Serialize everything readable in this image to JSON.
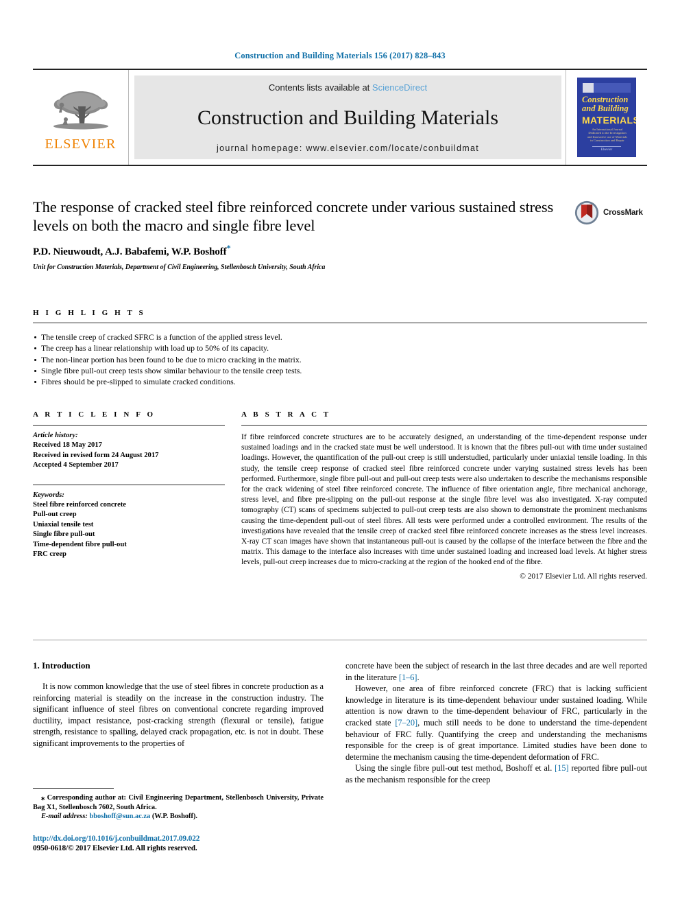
{
  "running_head": "Construction and Building Materials 156 (2017) 828–843",
  "masthead": {
    "contents_prefix": "Contents lists available at ",
    "sciencedirect": "ScienceDirect",
    "journal_title": "Construction and Building Materials",
    "homepage": "journal homepage: www.elsevier.com/locate/conbuildmat",
    "publisher_name": "ELSEVIER",
    "cover": {
      "line1": "Construction",
      "line2": "and Building",
      "line3": "MATERIALS",
      "subtitle": "An International Journal Dedicated to the Investigation and Innovative use of Materials in Construction and Repair",
      "footer": "Elsevier"
    }
  },
  "article": {
    "title": "The response of cracked steel fibre reinforced concrete under various sustained stress levels on both the macro and single fibre level",
    "authors": "P.D. Nieuwoudt, A.J. Babafemi, W.P. Boshoff",
    "corresponding_marker": "*",
    "affiliation": "Unit for Construction Materials, Department of Civil Engineering, Stellenbosch University, South Africa",
    "crossmark_label": "CrossMark"
  },
  "highlights": {
    "heading": "H I G H L I G H T S",
    "items": [
      "The tensile creep of cracked SFRC is a function of the applied stress level.",
      "The creep has a linear relationship with load up to 50% of its capacity.",
      "The non-linear portion has been found to be due to micro cracking in the matrix.",
      "Single fibre pull-out creep tests show similar behaviour to the tensile creep tests.",
      "Fibres should be pre-slipped to simulate cracked conditions."
    ]
  },
  "article_info": {
    "heading": "A R T I C L E    I N F O",
    "history_label": "Article history:",
    "received": "Received 18 May 2017",
    "revised": "Received in revised form 24 August 2017",
    "accepted": "Accepted 4 September 2017",
    "keywords_label": "Keywords:",
    "keywords": [
      "Steel fibre reinforced concrete",
      "Pull-out creep",
      "Uniaxial tensile test",
      "Single fibre pull-out",
      "Time-dependent fibre pull-out",
      "FRC creep"
    ]
  },
  "abstract": {
    "heading": "A B S T R A C T",
    "text": "If fibre reinforced concrete structures are to be accurately designed, an understanding of the time-dependent response under sustained loadings and in the cracked state must be well understood. It is known that the fibres pull-out with time under sustained loadings. However, the quantification of the pull-out creep is still understudied, particularly under uniaxial tensile loading. In this study, the tensile creep response of cracked steel fibre reinforced concrete under varying sustained stress levels has been performed. Furthermore, single fibre pull-out and pull-out creep tests were also undertaken to describe the mechanisms responsible for the crack widening of steel fibre reinforced concrete. The influence of fibre orientation angle, fibre mechanical anchorage, stress level, and fibre pre-slipping on the pull-out response at the single fibre level was also investigated. X-ray computed tomography (CT) scans of specimens subjected to pull-out creep tests are also shown to demonstrate the prominent mechanisms causing the time-dependent pull-out of steel fibres. All tests were performed under a controlled environment. The results of the investigations have revealed that the tensile creep of cracked steel fibre reinforced concrete increases as the stress level increases. X-ray CT scan images have shown that instantaneous pull-out is caused by the collapse of the interface between the fibre and the matrix. This damage to the interface also increases with time under sustained loading and increased load levels. At higher stress levels, pull-out creep increases due to micro-cracking at the region of the hooked end of the fibre.",
    "copyright": "© 2017 Elsevier Ltd. All rights reserved."
  },
  "body": {
    "section_heading": "1. Introduction",
    "left_paragraphs": [
      "It is now common knowledge that the use of steel fibres in concrete production as a reinforcing material is steadily on the increase in the construction industry. The significant influence of steel fibres on conventional concrete regarding improved ductility, impact resistance, post-cracking strength (flexural or tensile), fatigue strength, resistance to spalling, delayed crack propagation, etc. is not in doubt. These significant improvements to the properties of"
    ],
    "right_paragraphs": [
      {
        "indent": false,
        "segments": [
          {
            "t": "concrete have been the subject of research in the last three decades and are well reported in the literature ",
            "link": false
          },
          {
            "t": "[1–6]",
            "link": true
          },
          {
            "t": ".",
            "link": false
          }
        ]
      },
      {
        "indent": true,
        "segments": [
          {
            "t": "However, one area of fibre reinforced concrete (FRC) that is lacking sufficient knowledge in literature is its time-dependent behaviour under sustained loading. While attention is now drawn to the time-dependent behaviour of FRC, particularly in the cracked state ",
            "link": false
          },
          {
            "t": "[7–20]",
            "link": true
          },
          {
            "t": ", much still needs to be done to understand the time-dependent behaviour of FRC fully. Quantifying the creep and understanding the mechanisms responsible for the creep is of great importance. Limited studies have been done to determine the mechanism causing the time-dependent deformation of FRC.",
            "link": false
          }
        ]
      },
      {
        "indent": true,
        "segments": [
          {
            "t": "Using the single fibre pull-out test method, Boshoff et al. ",
            "link": false
          },
          {
            "t": "[15]",
            "link": true
          },
          {
            "t": " reported fibre pull-out as the mechanism responsible for the creep",
            "link": false
          }
        ]
      }
    ]
  },
  "footer": {
    "corresponding_marker": "⁎",
    "corresponding_text": " Corresponding author at: Civil Engineering Department, Stellenbosch University, Private Bag X1, Stellenbosch 7602, South Africa.",
    "email_label": "E-mail address:",
    "email": "bboshoff@sun.ac.za",
    "email_suffix": " (W.P. Boshoff).",
    "doi": "http://dx.doi.org/10.1016/j.conbuildmat.2017.09.022",
    "issn_line": "0950-0618/© 2017 Elsevier Ltd. All rights reserved."
  },
  "colors": {
    "link": "#1070a8",
    "sciencedirect": "#5aa3d6",
    "elsevier_orange": "#ef8100",
    "cover_blue": "#2c3fa0",
    "cover_yellow": "#ffd94a"
  }
}
